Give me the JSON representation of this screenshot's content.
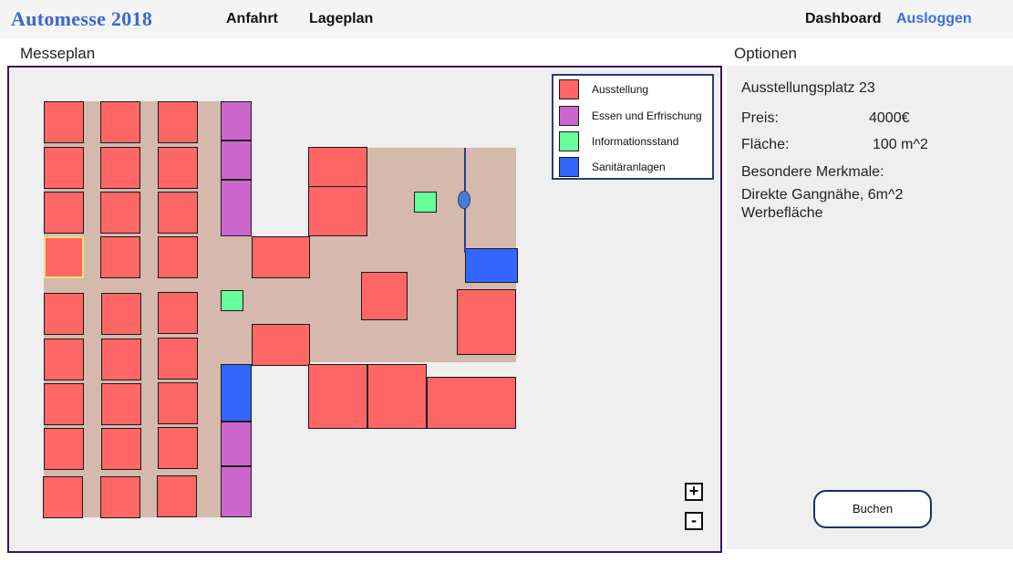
{
  "header": {
    "brand": "Automesse  2018",
    "nav": {
      "anfahrt": "Anfahrt",
      "lageplan": "Lageplan",
      "dashboard": "Dashboard",
      "logout": "Ausloggen"
    }
  },
  "map": {
    "title": "Messeplan",
    "legend": [
      {
        "label": "Ausstellung",
        "color": "#ff6666"
      },
      {
        "label": "Essen und Erfrischung",
        "color": "#cc66cc"
      },
      {
        "label": "Informationsstand",
        "color": "#66ff99"
      },
      {
        "label": "Sanitäranlagen",
        "color": "#3366ff"
      }
    ],
    "zoom_in": "+",
    "zoom_out": "-"
  },
  "options": {
    "title": "Optionen",
    "selected_name": "Ausstellungsplatz 23",
    "price_label": "Preis:",
    "price_value": "4000€",
    "area_label": "Fläche:",
    "area_value": "100 m^2",
    "features_label": "Besondere Merkmale:",
    "features_value_line1": "Direkte Gangnähe, 6m^2",
    "features_value_line2": "Werbefläche",
    "book_label": "Buchen"
  },
  "colors": {
    "exhibition": "#ff6666",
    "food": "#cc66cc",
    "info": "#66ff99",
    "sanitary": "#3366ff",
    "floor": "#d5b9ac",
    "brand": "#3b66d1"
  }
}
